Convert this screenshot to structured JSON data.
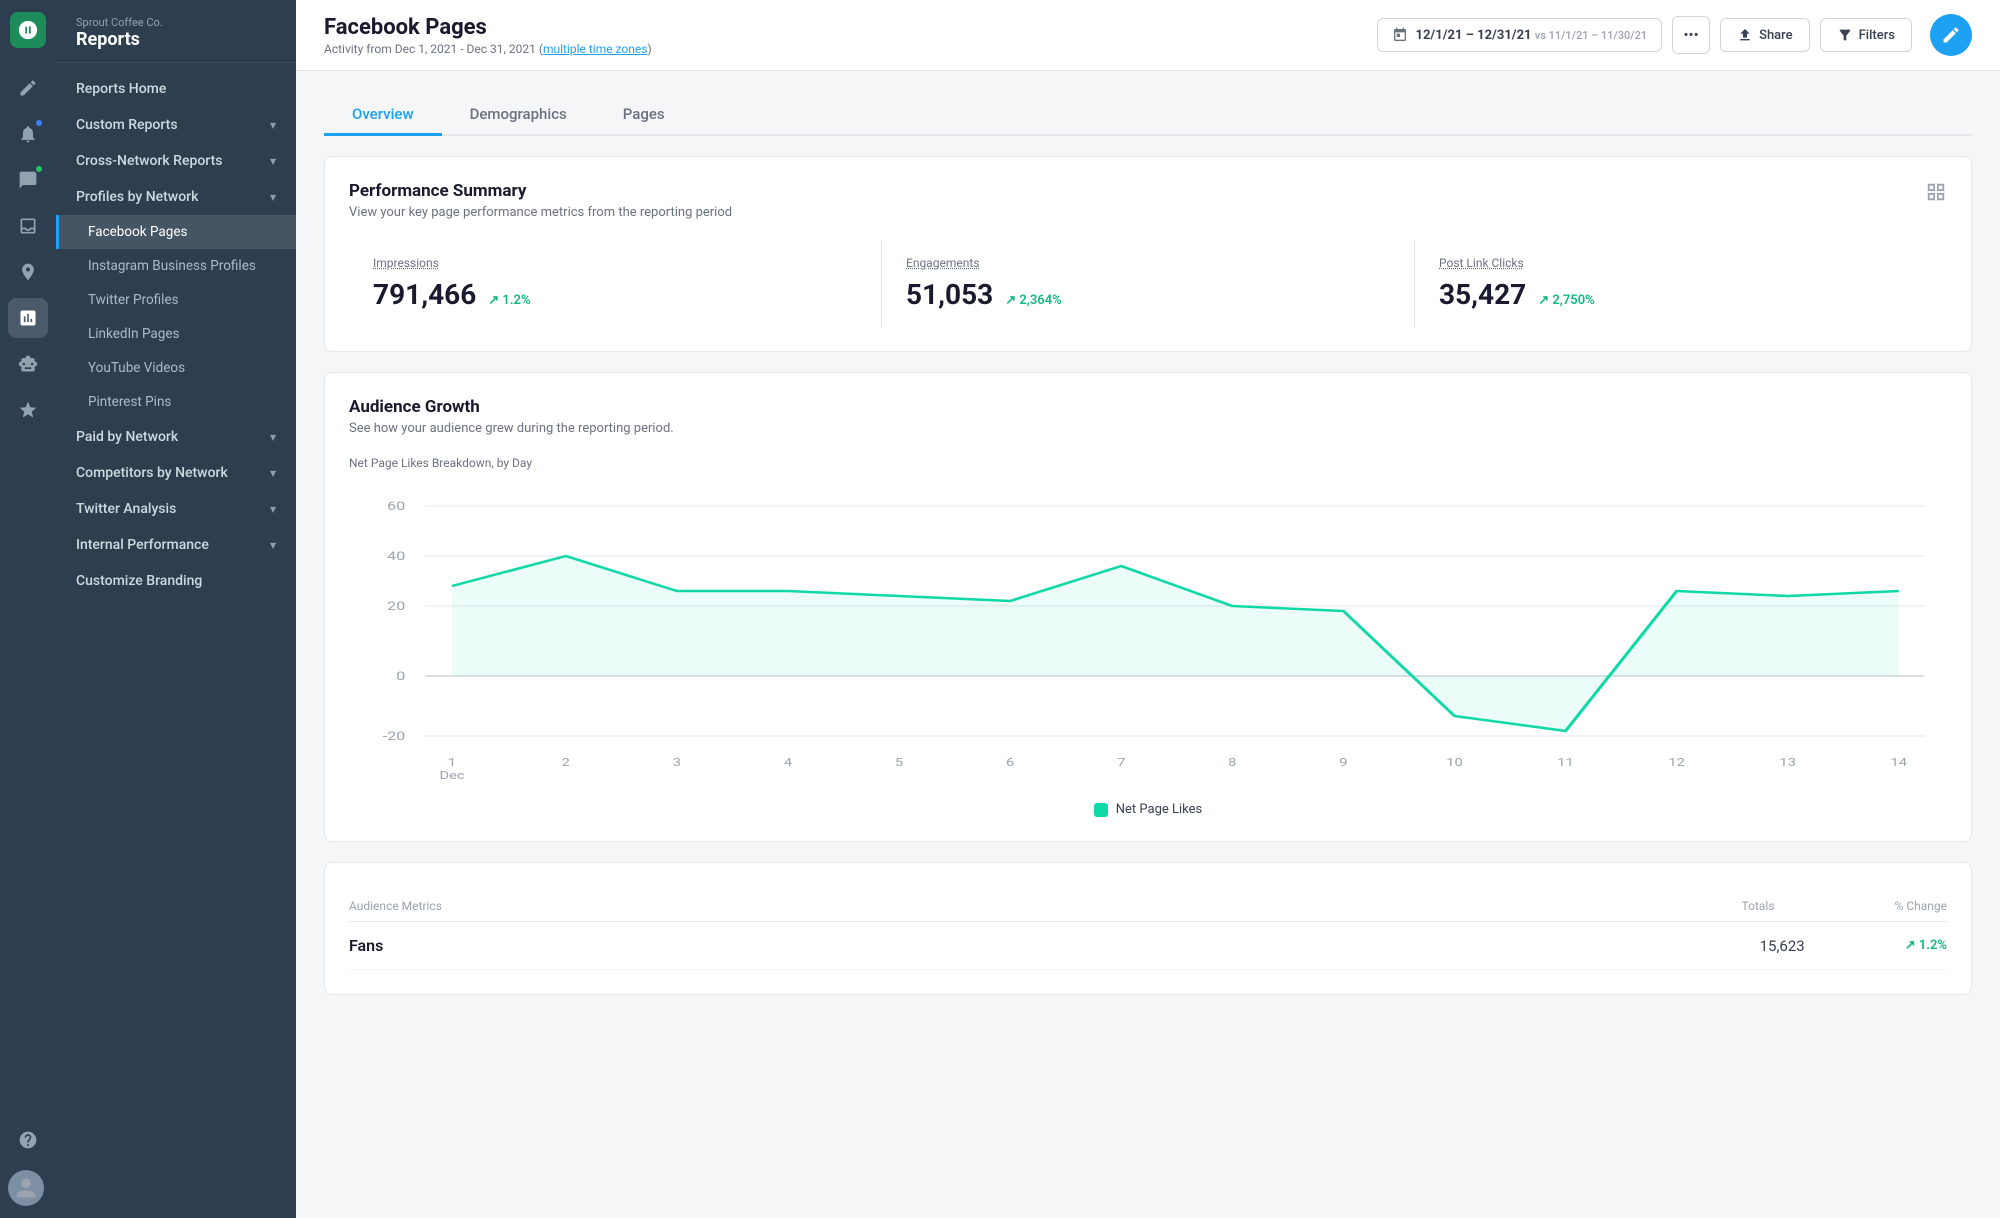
{
  "company": "Sprout Coffee Co.",
  "section": "Reports",
  "page": {
    "title": "Facebook Pages",
    "subtitle": "Activity from Dec 1, 2021 - Dec 31, 2021",
    "timezone_label": "multiple time zones",
    "date_range": "12/1/21 – 12/31/21",
    "date_vs": "vs 11/1/21 – 11/30/21"
  },
  "tabs": [
    {
      "label": "Overview",
      "active": true
    },
    {
      "label": "Demographics",
      "active": false
    },
    {
      "label": "Pages",
      "active": false
    }
  ],
  "performance": {
    "title": "Performance Summary",
    "subtitle": "View your key page performance metrics from the reporting period",
    "metrics": [
      {
        "label": "Impressions",
        "value": "791,466",
        "change": "1.2%",
        "up": true
      },
      {
        "label": "Engagements",
        "value": "51,053",
        "change": "2,364%",
        "up": true
      },
      {
        "label": "Post Link Clicks",
        "value": "35,427",
        "change": "2,750%",
        "up": true
      }
    ]
  },
  "audience_growth": {
    "title": "Audience Growth",
    "subtitle": "See how your audience grew during the reporting period.",
    "chart_label": "Net Page Likes Breakdown, by Day",
    "y_labels": [
      "60",
      "40",
      "20",
      "0",
      "-20"
    ],
    "x_labels": [
      "1\nDec",
      "2",
      "3",
      "4",
      "5",
      "6",
      "7",
      "8",
      "9",
      "10",
      "11",
      "12",
      "13",
      "14"
    ],
    "legend": "Net Page Likes"
  },
  "audience_metrics": {
    "title": "Audience Metrics",
    "col_totals": "Totals",
    "col_change": "% Change",
    "rows": [
      {
        "label": "Fans",
        "value": "15,623",
        "change": "1.2%",
        "up": true
      }
    ]
  },
  "sidebar": {
    "items": [
      {
        "label": "Reports Home",
        "type": "top",
        "key": "reports-home"
      },
      {
        "label": "Custom Reports",
        "type": "expandable",
        "expanded": false,
        "key": "custom-reports"
      },
      {
        "label": "Cross-Network Reports",
        "type": "expandable",
        "expanded": false,
        "key": "cross-network"
      },
      {
        "label": "Profiles by Network",
        "type": "expandable",
        "expanded": true,
        "key": "profiles-by-network"
      },
      {
        "label": "Facebook Pages",
        "type": "sub",
        "active": true,
        "key": "facebook-pages"
      },
      {
        "label": "Instagram Business Profiles",
        "type": "sub",
        "key": "instagram"
      },
      {
        "label": "Twitter Profiles",
        "type": "sub",
        "key": "twitter-profiles"
      },
      {
        "label": "LinkedIn Pages",
        "type": "sub",
        "key": "linkedin"
      },
      {
        "label": "YouTube Videos",
        "type": "sub",
        "key": "youtube"
      },
      {
        "label": "Pinterest Pins",
        "type": "sub",
        "key": "pinterest"
      },
      {
        "label": "Paid by Network",
        "type": "expandable",
        "expanded": false,
        "key": "paid-by-network"
      },
      {
        "label": "Competitors by Network",
        "type": "expandable",
        "expanded": false,
        "key": "competitors"
      },
      {
        "label": "Twitter Analysis",
        "type": "expandable",
        "expanded": false,
        "key": "twitter-analysis"
      },
      {
        "label": "Internal Performance",
        "type": "expandable",
        "expanded": false,
        "key": "internal-performance"
      },
      {
        "label": "Customize Branding",
        "type": "top",
        "key": "customize-branding"
      }
    ]
  },
  "icons": {
    "home": "🏠",
    "compose": "✏️",
    "bell": "🔔",
    "chat": "💬",
    "bookmark": "🔖",
    "inbox": "📥",
    "analytics": "📊",
    "robot": "🤖",
    "star": "⭐",
    "help": "❓",
    "calendar": "📅",
    "share": "↑",
    "filter": "⊟",
    "more": "•••",
    "grid": "⊞",
    "chevron_down": "▾",
    "arrow_up": "↗"
  },
  "colors": {
    "accent": "#1da1f2",
    "green": "#10b981",
    "teal_chart": "#10d9a8",
    "sidebar_bg": "#2d3e4f",
    "icon_bar_bg": "#2c3e50"
  }
}
